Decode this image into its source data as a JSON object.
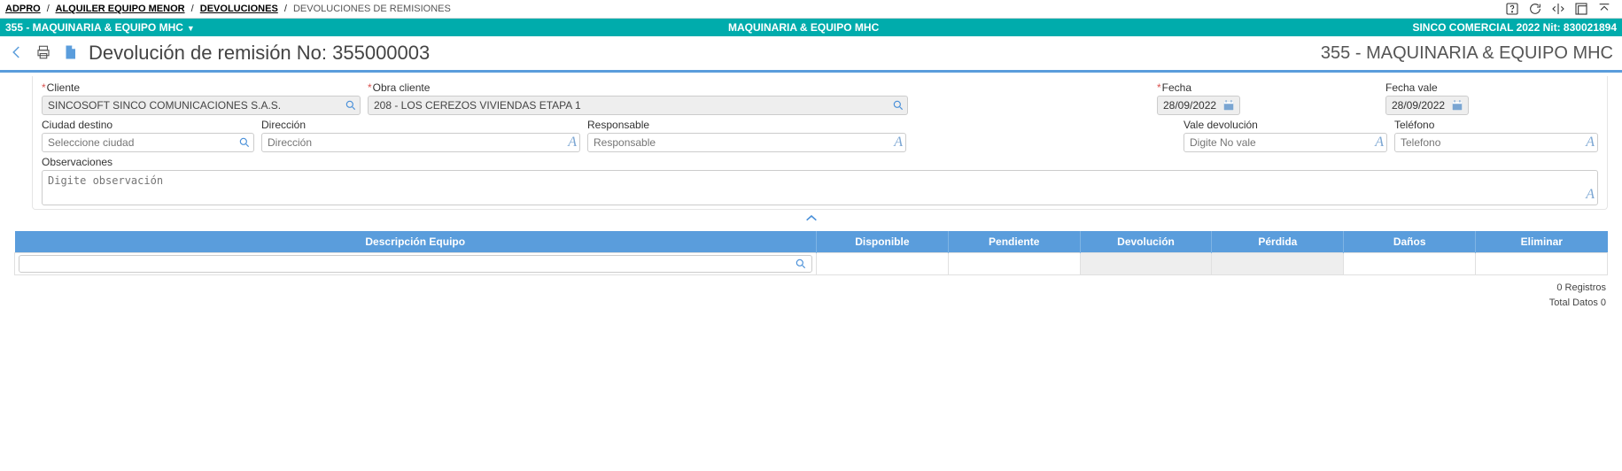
{
  "breadcrumb": {
    "items": [
      "ADPRO",
      "ALQUILER EQUIPO MENOR",
      "DEVOLUCIONES"
    ],
    "current": "DEVOLUCIONES DE REMISIONES"
  },
  "teal": {
    "left": "355 - MAQUINARIA & EQUIPO MHC",
    "center": "MAQUINARIA & EQUIPO MHC",
    "right": "SINCO COMERCIAL 2022 Nit: 830021894"
  },
  "title": {
    "page": "Devolución de remisión No: 355000003",
    "context": "355 - MAQUINARIA & EQUIPO MHC"
  },
  "form": {
    "cliente": {
      "label": "Cliente",
      "value": "SINCOSOFT SINCO COMUNICACIONES S.A.S."
    },
    "obra": {
      "label": "Obra cliente",
      "value": "208 - LOS CEREZOS VIVIENDAS ETAPA 1"
    },
    "fecha": {
      "label": "Fecha",
      "value": "28/09/2022"
    },
    "fechavale": {
      "label": "Fecha vale",
      "value": "28/09/2022"
    },
    "ciudad": {
      "label": "Ciudad destino",
      "placeholder": "Seleccione ciudad"
    },
    "direccion": {
      "label": "Dirección",
      "placeholder": "Dirección"
    },
    "responsable": {
      "label": "Responsable",
      "placeholder": "Responsable"
    },
    "vale": {
      "label": "Vale devolución",
      "placeholder": "Digite No vale"
    },
    "telefono": {
      "label": "Teléfono",
      "placeholder": "Telefono"
    },
    "observ": {
      "label": "Observaciones",
      "placeholder": "Digite observación"
    }
  },
  "table": {
    "headers": [
      "Descripción Equipo",
      "Disponible",
      "Pendiente",
      "Devolución",
      "Pérdida",
      "Daños",
      "Eliminar"
    ]
  },
  "summary": {
    "registros": "0 Registros",
    "total": "Total Datos 0"
  }
}
